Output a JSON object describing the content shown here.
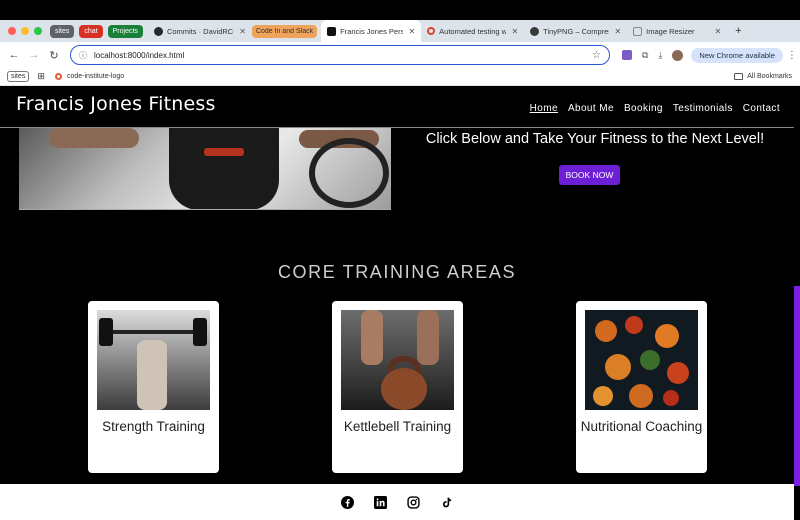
{
  "browser": {
    "tab_chips": [
      {
        "label": "sites",
        "color": "#5f6368"
      },
      {
        "label": "chat",
        "color": "#d93025"
      },
      {
        "label": "Projects",
        "color": "#188038"
      }
    ],
    "tabs": [
      {
        "label": "Commits · DavidRC-F",
        "icon": "github-icon"
      },
      {
        "label": "Code In and Slack",
        "icon": "",
        "highlight": true
      },
      {
        "label": "Francis Jones Person",
        "icon": "site-icon",
        "active": true
      },
      {
        "label": "Automated testing w",
        "icon": "ci-icon"
      },
      {
        "label": "TinyPNG – Compress",
        "icon": "panda-icon"
      },
      {
        "label": "Image Resizer",
        "icon": "resize-icon"
      }
    ],
    "new_tab": "+",
    "url": "localhost:8000/index.html",
    "update_button": "New Chrome available",
    "bookmarks": {
      "sites_chip": "sites",
      "logo_label": "code-institute-logo",
      "all_bookmarks": "All Bookmarks"
    }
  },
  "site": {
    "brand": "Francis Jones Fitness",
    "nav": [
      "Home",
      "About Me",
      "Booking",
      "Testimonials",
      "Contact"
    ],
    "hero": {
      "heading": "Click Below and Take Your Fitness to the Next Level!",
      "button": "BOOK NOW"
    },
    "section_title": "CORE TRAINING AREAS",
    "cards": [
      {
        "title": "Strength Training"
      },
      {
        "title": "Kettlebell Training"
      },
      {
        "title": "Nutritional Coaching"
      }
    ],
    "footer_icons": [
      "facebook-icon",
      "linkedin-icon",
      "instagram-icon",
      "tiktok-icon"
    ]
  },
  "colors": {
    "accent": "#6d1fd6",
    "page_bg": "#000000",
    "omnibox_border": "#2a5bd7"
  }
}
